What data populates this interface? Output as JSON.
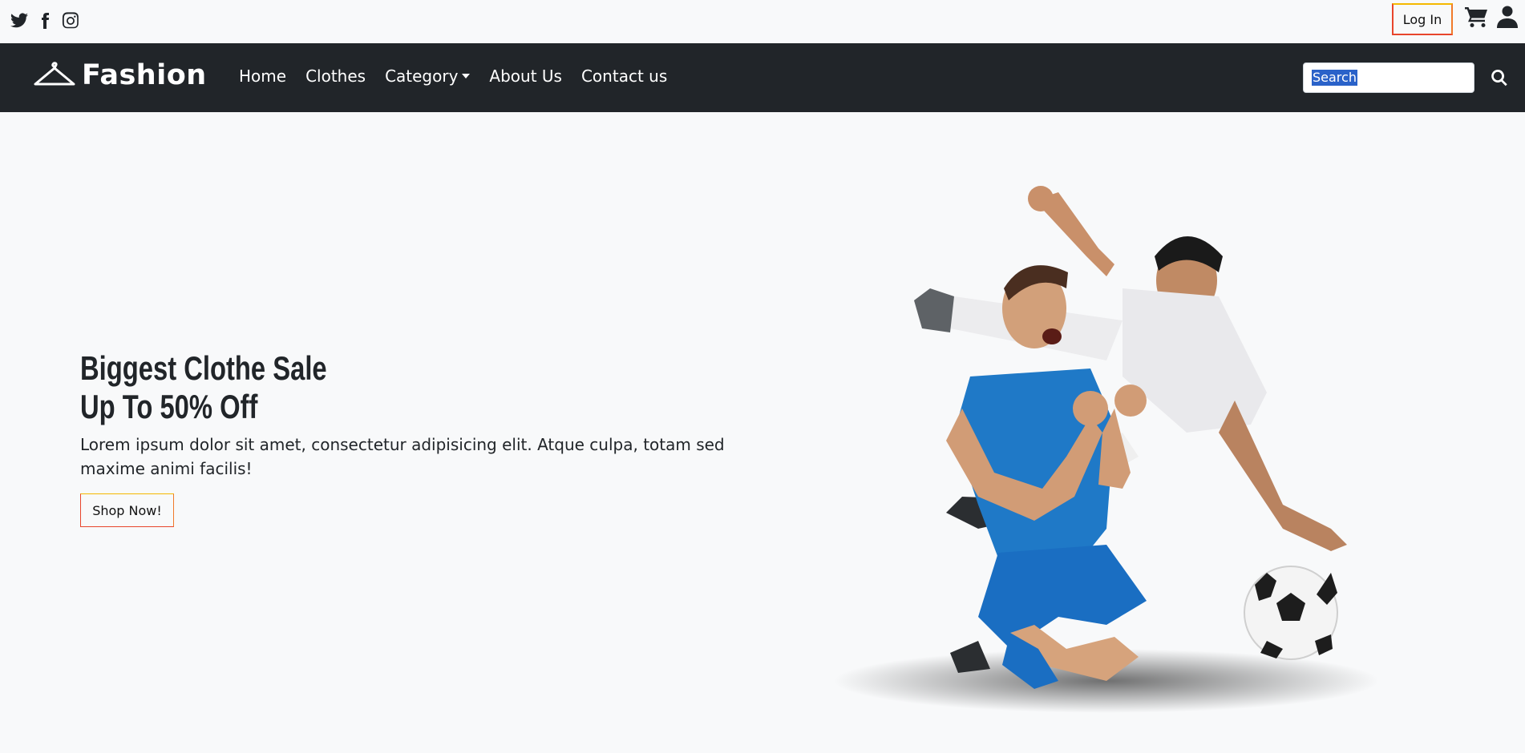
{
  "topbar": {
    "social_icons": [
      "twitter-icon",
      "facebook-icon",
      "instagram-icon"
    ],
    "login_label": "Log In",
    "cart_icon": "cart-icon",
    "user_icon": "user-icon"
  },
  "navbar": {
    "brand": "Fashion",
    "brand_icon": "hanger-icon",
    "links": [
      {
        "label": "Home"
      },
      {
        "label": "Clothes"
      },
      {
        "label": "Category",
        "dropdown": true
      },
      {
        "label": "About Us"
      },
      {
        "label": "Contact us"
      }
    ],
    "search": {
      "placeholder": "Search",
      "value": "",
      "selected_text": "Search"
    },
    "search_icon": "search-icon"
  },
  "hero": {
    "title_line1": "Biggest Clothe Sale",
    "title_line2": "Up To 50% Off",
    "description": "Lorem ipsum dolor sit amet, consectetur adipisicing elit. Atque culpa, totam sed maxime animi facilis!",
    "button_label": "Shop Now!"
  },
  "colors": {
    "navbar_bg": "#212529",
    "page_bg": "#f8f9fa",
    "accent_border": "#e8452c",
    "selection": "#2a62c9"
  }
}
